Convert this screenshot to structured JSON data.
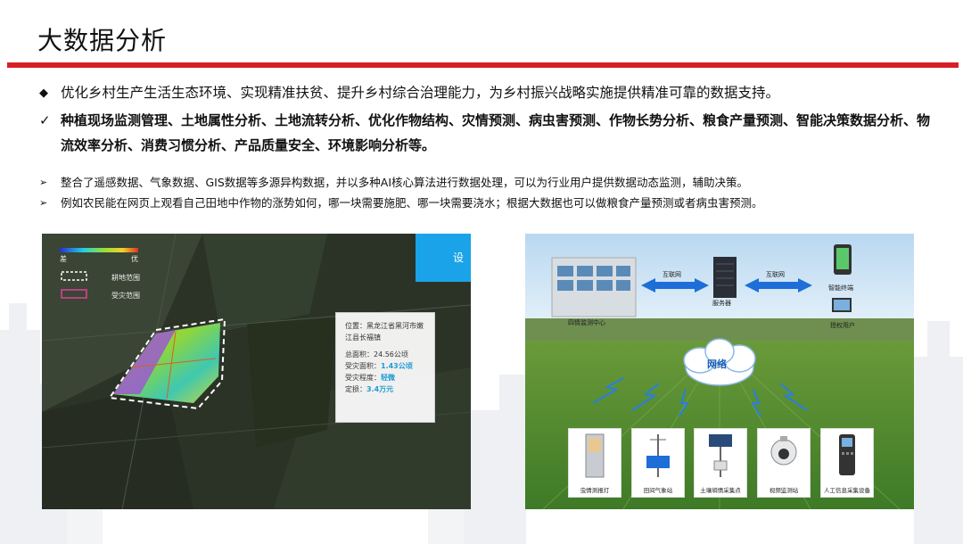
{
  "title": "大数据分析",
  "colors": {
    "accent_bar": "#d91f26",
    "highlight": "#1e9bd6"
  },
  "bullets": {
    "diamond": "优化乡村生产生活生态环境、实现精准扶贫、提升乡村综合治理能力，为乡村振兴战略实施提供精准可靠的数据支持。",
    "check": "种植现场监测管理、土地属性分析、土地流转分析、优化作物结构、灾情预测、病虫害预测、作物长势分析、粮食产量预测、智能决策数据分析、物流效率分析、消费习惯分析、产品质量安全、环境影响分析等。",
    "arrow1": "整合了遥感数据、气象数据、GIS数据等多源异构数据，并以多种AI核心算法进行数据处理，可以为行业用户提供数据动态监测，辅助决策。",
    "arrow2": "例如农民能在网页上观看自己田地中作物的涨势如何，哪一块需要施肥、哪一块需要浇水；根据大数据也可以做粮食产量预测或者病虫害预测。"
  },
  "markers": {
    "diamond": "◆",
    "check": "✓",
    "arrow": "➢"
  },
  "left_image": {
    "legend_low": "差",
    "legend_high": "优",
    "legend_cultivated": "耕地范围",
    "legend_disaster": "受灾范围",
    "blue_box_char": "设",
    "info": {
      "location": "位置：黑龙江省黑河市嫩江县长福镇",
      "total_area": "总面积：24.56公顷",
      "affected_label": "受灾面积：",
      "affected_value": "1.43公顷",
      "degree_label": "受灾程度：",
      "degree_value": "轻微",
      "loss_label": "定损：",
      "loss_value": "3.4万元"
    }
  },
  "right_image": {
    "center_label": "四情监测中心",
    "server_label": "服务器",
    "internet_left": "互联网",
    "internet_right": "互联网",
    "terminal_label": "智能终端",
    "user_label": "授权用户",
    "network_label": "网络",
    "devices": [
      "虫情测报灯",
      "田间气象站",
      "土壤墒情采集点",
      "视频监测站",
      "人工信息采集设备"
    ]
  }
}
